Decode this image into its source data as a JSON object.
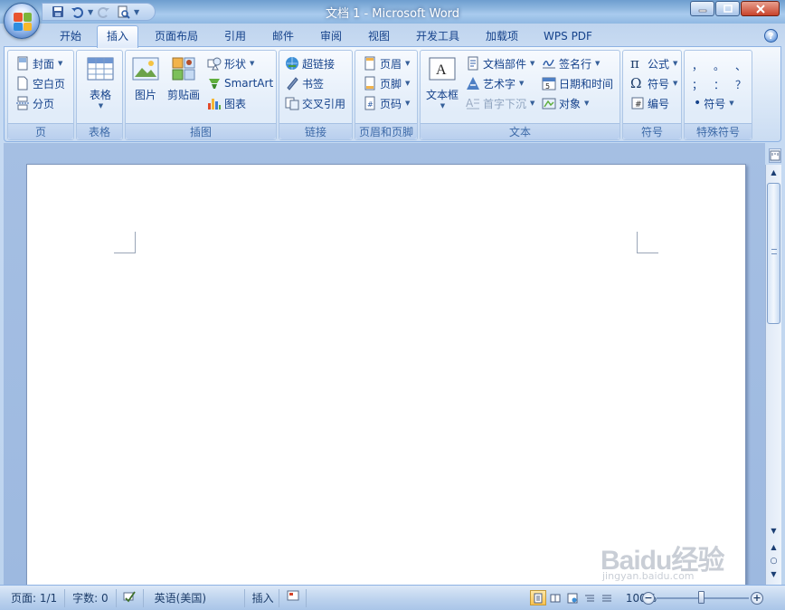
{
  "window": {
    "title": "文档 1 - Microsoft Word"
  },
  "tabs": [
    "开始",
    "插入",
    "页面布局",
    "引用",
    "邮件",
    "审阅",
    "视图",
    "开发工具",
    "加载项",
    "WPS PDF"
  ],
  "active_tab": "插入",
  "ribbon": {
    "pages": {
      "label": "页",
      "items": [
        "封面",
        "空白页",
        "分页"
      ]
    },
    "table": {
      "label": "表格",
      "item": "表格"
    },
    "illustrations": {
      "label": "插图",
      "picture": "图片",
      "clipart": "剪贴画",
      "shapes": "形状",
      "smartart": "SmartArt",
      "chart": "图表"
    },
    "links": {
      "label": "链接",
      "items": [
        "超链接",
        "书签",
        "交叉引用"
      ]
    },
    "header_footer": {
      "label": "页眉和页脚",
      "items": [
        "页眉",
        "页脚",
        "页码"
      ]
    },
    "text": {
      "label": "文本",
      "textbox": "文本框",
      "quickparts": "文档部件",
      "wordart": "艺术字",
      "dropcap": "首字下沉",
      "signature": "签名行",
      "datetime": "日期和时间",
      "object": "对象"
    },
    "symbols": {
      "label": "符号",
      "equation": "公式",
      "symbol": "符号",
      "number": "编号"
    },
    "special": {
      "label": "特殊符号",
      "chars": [
        "，",
        "。",
        "、",
        "；",
        "：",
        "？"
      ],
      "symbol": "符号"
    }
  },
  "status": {
    "page": "页面: 1/1",
    "words": "字数: 0",
    "language": "英语(美国)",
    "mode": "插入",
    "zoom": "100%"
  },
  "watermark": {
    "brand": "Baidu经验",
    "url": "jingyan.baidu.com"
  },
  "colors": {
    "ribbon": "#dbe8f7",
    "text": "#15428b",
    "titlebar": "#8db6df"
  }
}
